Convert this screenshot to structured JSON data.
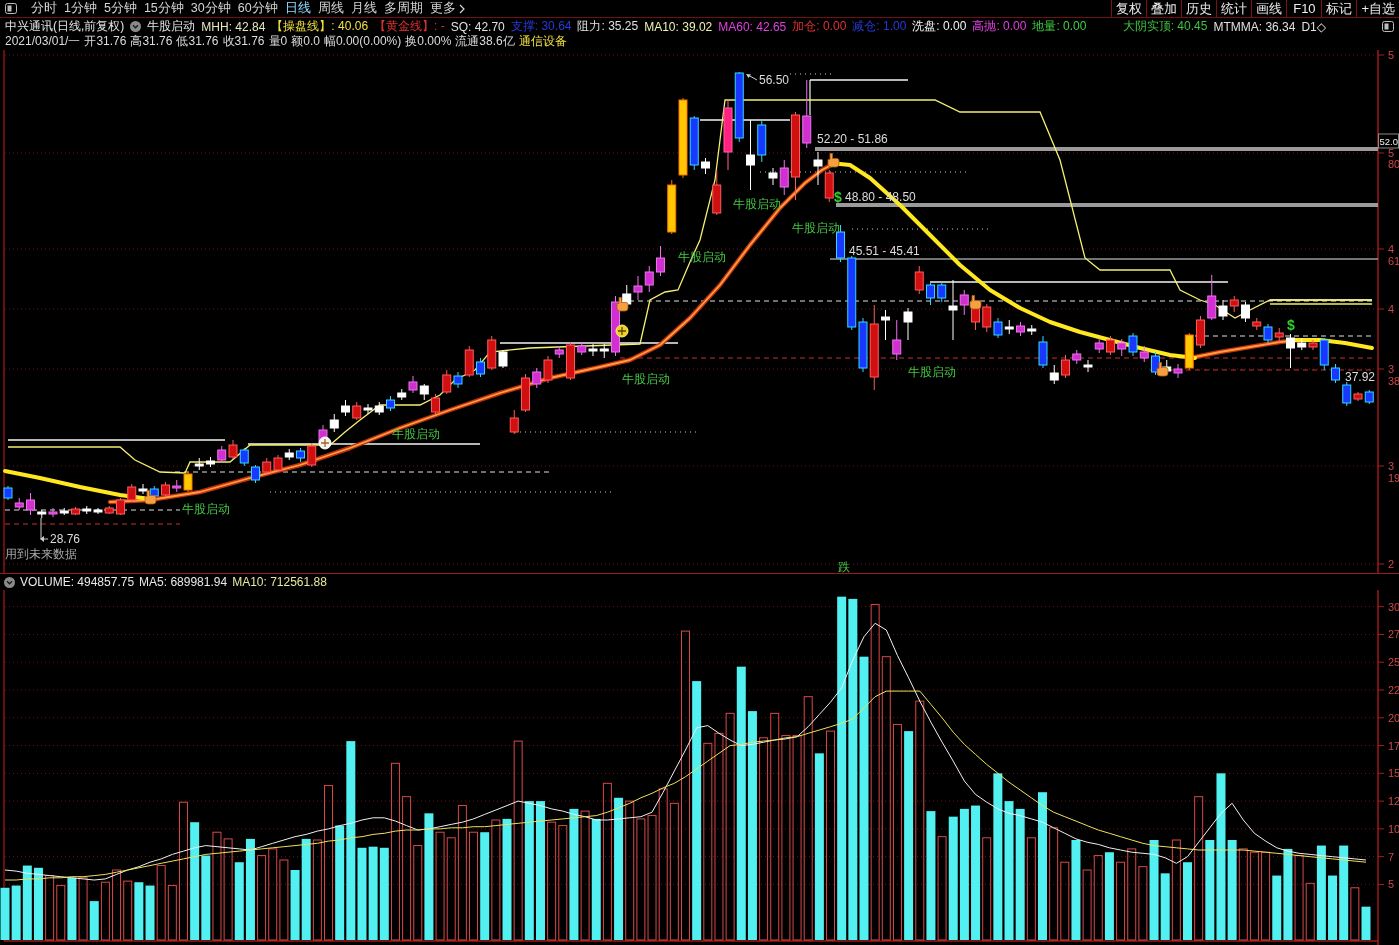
{
  "toolbar": {
    "periods": [
      {
        "label": "分时",
        "selected": false
      },
      {
        "label": "1分钟",
        "selected": false
      },
      {
        "label": "5分钟",
        "selected": false
      },
      {
        "label": "15分钟",
        "selected": false
      },
      {
        "label": "30分钟",
        "selected": false
      },
      {
        "label": "60分钟",
        "selected": false
      },
      {
        "label": "日线",
        "selected": true
      },
      {
        "label": "周线",
        "selected": false
      },
      {
        "label": "月线",
        "selected": false
      },
      {
        "label": "多周期",
        "selected": false
      }
    ],
    "more": "更多",
    "tools": [
      "复权",
      "叠加",
      "历史",
      "统计",
      "画线",
      "F10",
      "标记",
      "+自选"
    ]
  },
  "quote_header": {
    "title": "中兴通讯(日线,前复权)",
    "indicator": "牛股启动",
    "indicators": [
      {
        "text": "MHH: 42.84",
        "color": "#e8e8c0"
      },
      {
        "text": "【操盘线】: 40.06",
        "color": "#f0e040"
      },
      {
        "text": "【黄金线】: -",
        "color": "#e03030"
      },
      {
        "text": "SQ: 42.70",
        "color": "#e0e0e0"
      },
      {
        "text": "支撑: 30.64",
        "color": "#2838d8"
      },
      {
        "text": "阻力: 35.25",
        "color": "#e0e0e0"
      },
      {
        "text": "MA10: 39.02",
        "color": "#f0f0b0"
      },
      {
        "text": "MA60: 42.65",
        "color": "#e040e0"
      },
      {
        "text": "加仓: 0.00",
        "color": "#e03030"
      },
      {
        "text": "减仓: 1.00",
        "color": "#2838d8"
      },
      {
        "text": "洗盘: 0.00",
        "color": "#f4f4f4"
      },
      {
        "text": "高抛: 0.00",
        "color": "#e040e0"
      },
      {
        "text": "地量: 0.00",
        "color": "#40d040"
      }
    ],
    "right_indicators": [
      {
        "text": "大阴实顶: 40.45",
        "color": "#40c040"
      },
      {
        "text": "MTMMA: 36.34",
        "color": "#e0e0e0"
      },
      {
        "text": "D1◇",
        "color": "#e0e0e0"
      }
    ],
    "stats": [
      "2021/03/01/一",
      "开31.76",
      "高31.76",
      "低31.76",
      "收31.76",
      "量0",
      "额0.0",
      "幅0.00(0.00%)",
      "换0.00%",
      "流通38.6亿"
    ],
    "industry": "通信设备"
  },
  "main_chart": {
    "signals": [
      "牛股启动",
      "牛股启动",
      "牛股启动",
      "牛股启动",
      "牛股启动",
      "牛股启动",
      "牛股启动"
    ],
    "price_labels": [
      "56.50",
      "52.20 - 51.86",
      "48.80 - 48.50",
      "45.51 - 45.41",
      "37.92",
      "28.76"
    ],
    "markers": [
      "$",
      "$"
    ],
    "note": "用到未来数据",
    "bottom_label": "跌",
    "axis_labels": [
      "5",
      "5",
      "80",
      "4",
      "61",
      "4",
      "3",
      "38",
      "3",
      "19",
      "2"
    ],
    "current_price": "52.0"
  },
  "volume_chart": {
    "values": [
      {
        "text": "VOLUME: 494857.75",
        "color": "#e8e8e8"
      },
      {
        "text": "MA5: 689981.94",
        "color": "#e8e8e8"
      },
      {
        "text": "MA10: 712561.88",
        "color": "#e8e8a0"
      }
    ],
    "chart_data": {
      "type": "bar",
      "stacked": true,
      "grid": true,
      "ylim": [
        0,
        31.5
      ],
      "yticks": [
        {
          "value": 30,
          "label": "30"
        },
        {
          "value": 27.5,
          "label": "27"
        },
        {
          "value": 25,
          "label": "25"
        },
        {
          "value": 22.5,
          "label": "22"
        },
        {
          "value": 20,
          "label": "20"
        },
        {
          "value": 17.5,
          "label": "17"
        },
        {
          "value": 15,
          "label": "15"
        },
        {
          "value": 12.5,
          "label": "12"
        },
        {
          "value": 10,
          "label": "10"
        },
        {
          "value": 7.5,
          "label": "7"
        },
        {
          "value": 5,
          "label": "5"
        }
      ],
      "series": [
        {
          "color": "#52f0f0",
          "values": [
            4.7,
            4.9,
            6.7,
            6.5,
            null,
            null,
            5.6,
            null,
            3.5,
            null,
            null,
            null,
            5.2,
            4.9,
            null,
            null,
            null,
            10.6,
            7.6,
            null,
            null,
            7.0,
            9.1,
            null,
            null,
            null,
            6.3,
            9.1,
            null,
            null,
            10.3,
            17.9,
            8.3,
            8.4,
            8.3,
            null,
            null,
            null,
            11.4,
            null,
            null,
            null,
            null,
            9.7,
            null,
            10.9,
            null,
            12.5,
            12.5,
            null,
            null,
            11.8,
            null,
            10.9,
            null,
            12.8,
            null,
            null,
            null,
            null,
            null,
            null,
            23.3,
            null,
            null,
            null,
            24.6,
            20.6,
            null,
            null,
            null,
            null,
            null,
            16.8,
            null,
            30.9,
            30.7,
            25.5,
            null,
            null,
            null,
            18.8,
            null,
            11.6,
            null,
            11.1,
            11.8,
            12.1,
            null,
            15.0,
            12.5,
            11.8,
            null,
            13.3,
            null,
            null,
            9.0,
            null,
            null,
            7.9,
            null,
            null,
            null,
            9.0,
            6.0,
            null,
            7.0,
            null,
            9.0,
            15.0,
            9.0,
            null,
            null,
            null,
            5.8,
            8.2,
            null,
            null,
            8.5,
            5.8,
            8.5,
            null,
            3.0
          ]
        },
        {
          "color": "#d84848",
          "values": [
            null,
            null,
            null,
            null,
            5.8,
            4.9,
            null,
            5.6,
            null,
            5.2,
            6.3,
            5.3,
            null,
            null,
            6.7,
            4.9,
            12.4,
            null,
            null,
            9.7,
            9.1,
            null,
            null,
            7.6,
            8.2,
            7.2,
            null,
            null,
            9.0,
            13.9,
            null,
            null,
            null,
            null,
            null,
            15.9,
            12.9,
            8.5,
            null,
            9.7,
            9.2,
            12.1,
            9.7,
            null,
            10.8,
            null,
            17.9,
            null,
            null,
            10.6,
            10.3,
            null,
            11.6,
            null,
            14.1,
            null,
            12.5,
            10.9,
            11.2,
            13.6,
            12.3,
            27.8,
            null,
            17.7,
            18.6,
            20.4,
            null,
            null,
            18.2,
            20.4,
            18.4,
            18.4,
            21.9,
            null,
            18.8,
            null,
            null,
            null,
            30.2,
            25.5,
            19.4,
            null,
            21.5,
            null,
            9.3,
            null,
            null,
            null,
            9.2,
            null,
            null,
            null,
            9.2,
            null,
            10.1,
            7.0,
            null,
            6.3,
            7.6,
            null,
            7.0,
            8.2,
            6.6,
            null,
            null,
            9.0,
            null,
            12.9,
            null,
            null,
            null,
            8.2,
            7.9,
            7.9,
            null,
            null,
            7.6,
            5.1,
            null,
            null,
            null,
            4.7,
            null
          ]
        },
        {
          "type": "line",
          "color": "#f0f0f0",
          "values": [
            6.3,
            6.2,
            6.0,
            5.9,
            5.8,
            5.7,
            5.6,
            5.5,
            5.4,
            5.5,
            5.9,
            6.3,
            6.6,
            7.0,
            7.3,
            7.7,
            8.0,
            8.3,
            8.5,
            8.4,
            8.3,
            8.2,
            8.1,
            8.4,
            8.7,
            9.0,
            9.3,
            9.5,
            9.8,
            10.0,
            10.3,
            10.5,
            10.8,
            11.0,
            11.0,
            10.7,
            10.3,
            9.9,
            10.0,
            10.2,
            10.4,
            10.6,
            10.9,
            11.3,
            11.7,
            12.1,
            12.5,
            12.3,
            12.1,
            11.8,
            11.6,
            11.3,
            11.1,
            10.8,
            10.8,
            10.9,
            11.0,
            11.1,
            11.5,
            13.3,
            15.2,
            17.1,
            19.1,
            19.3,
            18.6,
            18.0,
            17.5,
            17.6,
            17.8,
            18.0,
            18.1,
            18.3,
            19.2,
            20.3,
            21.4,
            22.7,
            25.2,
            27.3,
            28.5,
            27.9,
            25.6,
            23.6,
            21.5,
            19.6,
            17.8,
            16.1,
            14.3,
            13.1,
            12.4,
            11.8,
            11.4,
            11.2,
            10.9,
            10.6,
            10.1,
            9.6,
            9.1,
            8.8,
            8.6,
            8.3,
            8.1,
            7.9,
            7.8,
            7.7,
            7.4,
            6.9,
            7.5,
            8.8,
            10.1,
            11.4,
            12.3,
            10.8,
            9.6,
            8.9,
            8.3,
            8.0,
            7.8,
            7.7,
            7.6,
            7.5,
            7.4,
            7.3,
            7.2
          ]
        },
        {
          "type": "line",
          "color": "#f0e060",
          "values": [
            5.4,
            5.4,
            5.5,
            5.5,
            5.6,
            5.6,
            5.7,
            5.7,
            5.8,
            5.9,
            6.1,
            6.3,
            6.5,
            6.7,
            6.9,
            7.1,
            7.3,
            7.5,
            7.7,
            7.8,
            7.9,
            8.0,
            8.1,
            8.2,
            8.3,
            8.4,
            8.5,
            8.6,
            8.7,
            8.9,
            9.0,
            9.2,
            9.3,
            9.5,
            9.6,
            9.8,
            9.9,
            9.9,
            10.0,
            10.0,
            10.1,
            10.1,
            10.2,
            10.2,
            10.3,
            10.4,
            10.5,
            10.6,
            10.7,
            10.8,
            10.9,
            11.0,
            11.1,
            11.2,
            11.5,
            11.9,
            12.3,
            12.8,
            13.2,
            13.7,
            14.1,
            14.7,
            15.4,
            16.1,
            16.8,
            17.5,
            17.6,
            17.8,
            17.9,
            18.0,
            18.2,
            18.3,
            18.6,
            18.9,
            19.2,
            19.5,
            19.9,
            20.9,
            21.9,
            22.4,
            22.4,
            22.4,
            22.4,
            21.2,
            20.0,
            18.7,
            17.6,
            16.7,
            15.8,
            15.0,
            14.2,
            13.5,
            12.8,
            12.1,
            11.5,
            11.1,
            10.7,
            10.3,
            9.9,
            9.6,
            9.3,
            9.0,
            8.7,
            8.5,
            8.4,
            8.3,
            8.2,
            8.1,
            8.1,
            8.1,
            8.1,
            8.1,
            8.0,
            7.9,
            7.8,
            7.7,
            7.6,
            7.5,
            7.4,
            7.3,
            7.2,
            7.1,
            7.0
          ]
        }
      ]
    }
  }
}
